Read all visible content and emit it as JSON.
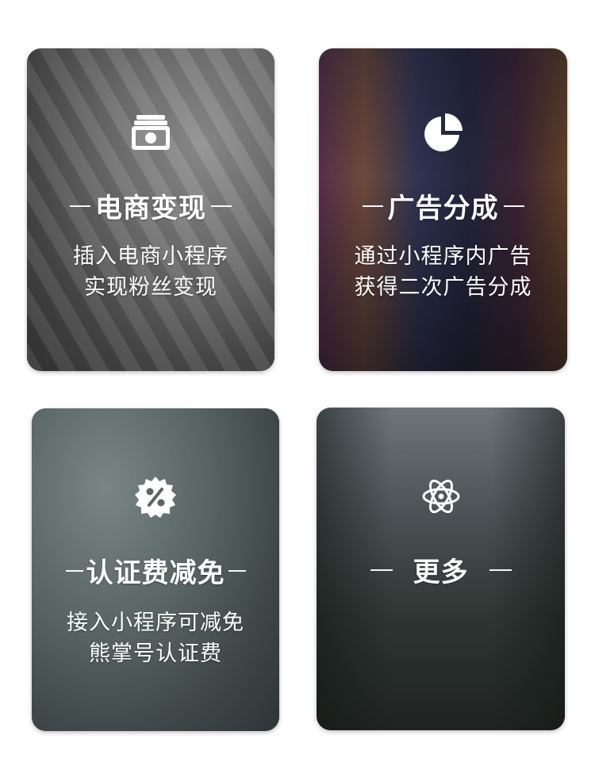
{
  "cards": [
    {
      "id": "ecommerce",
      "icon": "money-stack-icon",
      "title": "电商变现",
      "desc_lines": [
        "插入电商小程序",
        "实现粉丝变现"
      ]
    },
    {
      "id": "ads",
      "icon": "pie-chart-icon",
      "title": "广告分成",
      "desc_lines": [
        "通过小程序内广告",
        "获得二次广告分成"
      ]
    },
    {
      "id": "certification",
      "icon": "discount-percent-icon",
      "title": "认证费减免",
      "desc_lines": [
        "接入小程序可减免",
        "熊掌号认证费"
      ]
    },
    {
      "id": "more",
      "icon": "atom-icon",
      "title": "更多",
      "desc_lines": []
    }
  ],
  "colors": {
    "text": "#ffffff",
    "page_background": "#ffffff"
  }
}
